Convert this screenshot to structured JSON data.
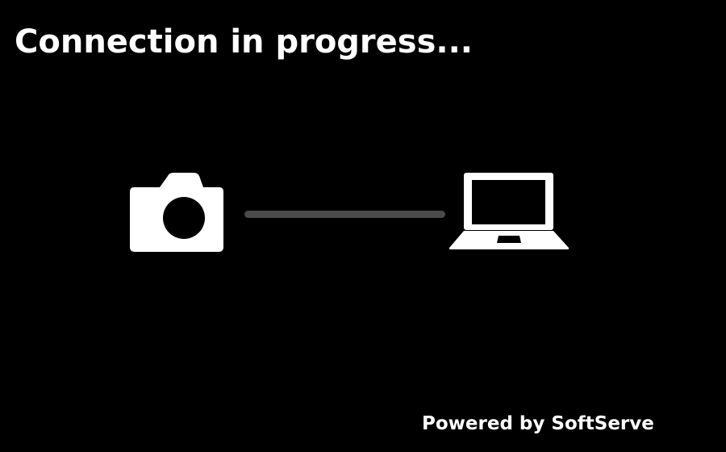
{
  "screen": {
    "title": "Connection in progress...",
    "footer": "Powered by SoftServe"
  },
  "icons": {
    "source": "camera-icon",
    "target": "laptop-icon"
  },
  "colors": {
    "background": "#000000",
    "foreground": "#ffffff",
    "connection_line": "#4a4a4a"
  }
}
